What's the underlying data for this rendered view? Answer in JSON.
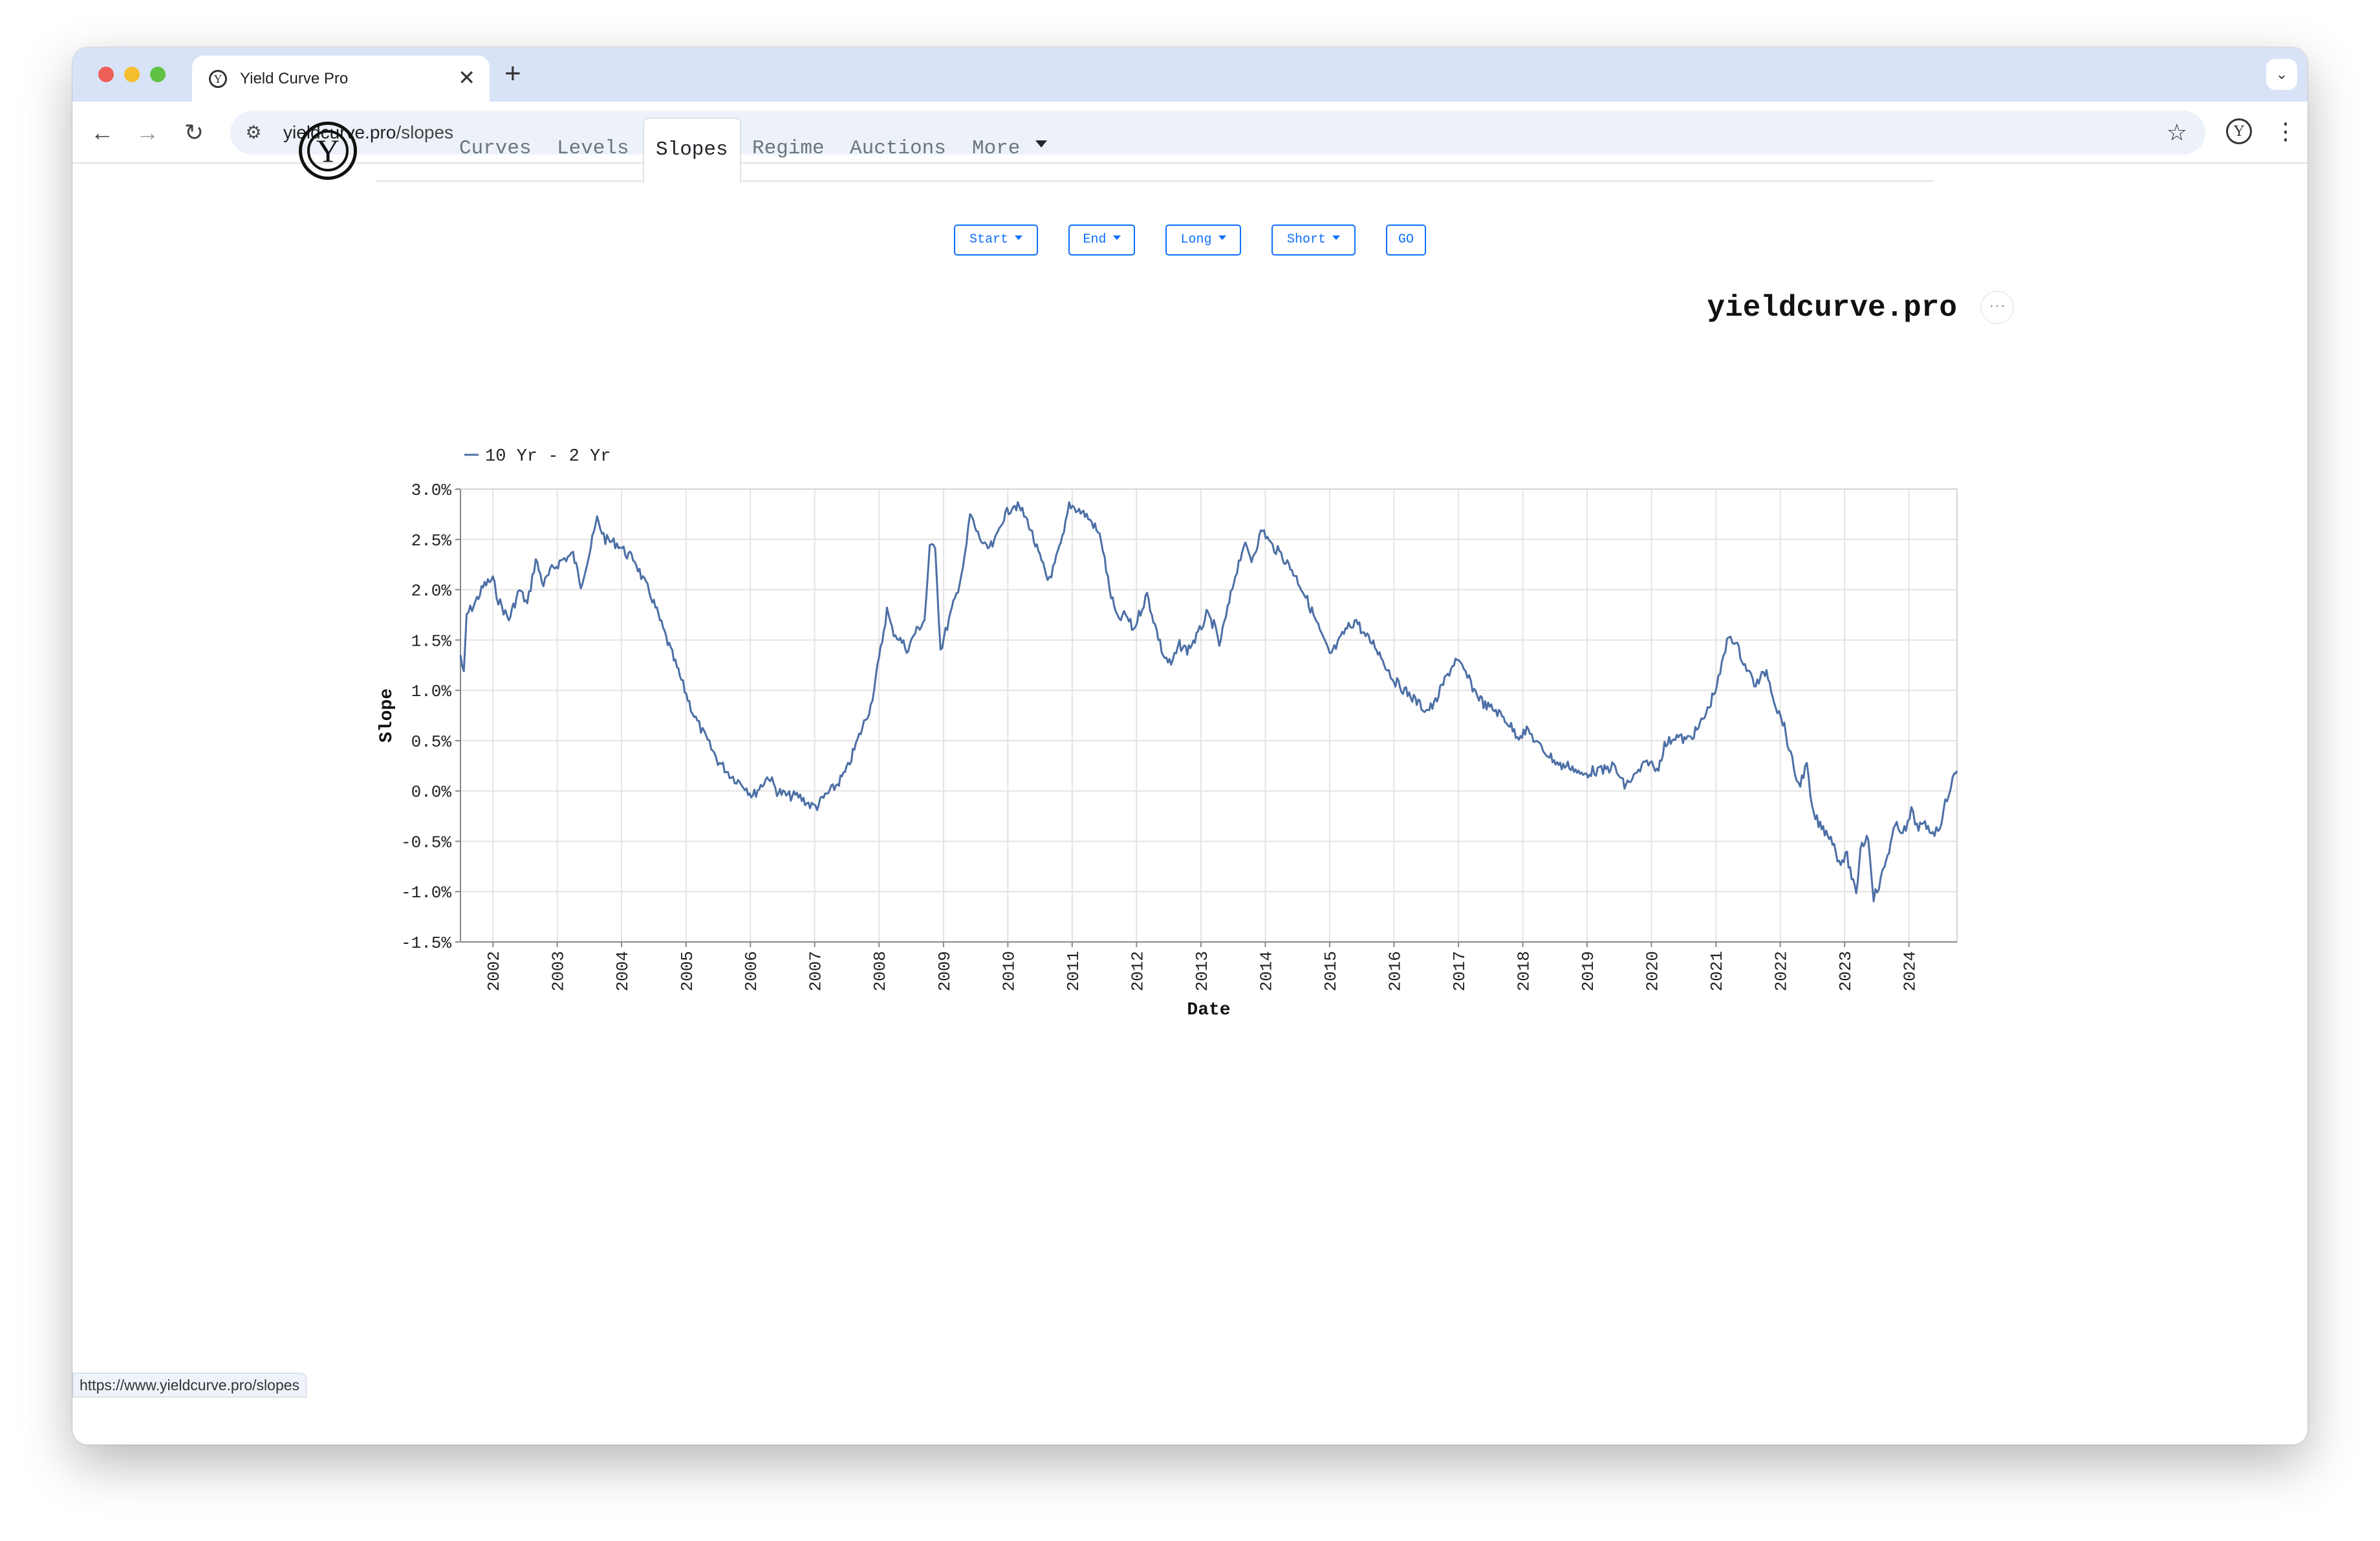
{
  "browser": {
    "tab_title": "Yield Curve Pro",
    "tab_close": "✕",
    "new_tab": "+",
    "url_domain": "yieldcurve.pro",
    "url_path": "/slopes",
    "status_url": "https://www.yieldcurve.pro/slopes"
  },
  "site": {
    "logo_letter": "Y",
    "nav": [
      "Curves",
      "Levels",
      "Slopes",
      "Regime",
      "Auctions",
      "More"
    ],
    "active_nav": "Slopes"
  },
  "filters": {
    "start": "Start",
    "end": "End",
    "long": "Long",
    "short": "Short",
    "go": "GO"
  },
  "chart_brand": "yieldcurve.pro",
  "chart_menu_icon": "···",
  "chart_data": {
    "type": "line",
    "title": "",
    "xlabel": "Date",
    "ylabel": "Slope",
    "x_tick_labels": [
      "2002",
      "2003",
      "2004",
      "2005",
      "2006",
      "2007",
      "2008",
      "2009",
      "2010",
      "2011",
      "2012",
      "2013",
      "2014",
      "2015",
      "2016",
      "2017",
      "2018",
      "2019",
      "2020",
      "2021",
      "2022",
      "2023",
      "2024"
    ],
    "y_tick_labels": [
      "3.0%",
      "2.5%",
      "2.0%",
      "1.5%",
      "1.0%",
      "0.5%",
      "0.0%",
      "-0.5%",
      "-1.0%",
      "-1.5%"
    ],
    "xlim": [
      "2001-07-01",
      "2024-09-30"
    ],
    "ylim": [
      -1.5,
      3.0
    ],
    "grid": true,
    "legend_position": "top-left",
    "color": "#4c6fa5",
    "series": [
      {
        "name": "10 Yr - 2 Yr",
        "points": [
          [
            "2001-07-01",
            1.35
          ],
          [
            "2001-07-20",
            1.15
          ],
          [
            "2001-08-05",
            1.75
          ],
          [
            "2001-09-15",
            1.85
          ],
          [
            "2001-11-15",
            2.05
          ],
          [
            "2001-12-31",
            2.1
          ],
          [
            "2002-02-01",
            1.9
          ],
          [
            "2002-04-01",
            1.7
          ],
          [
            "2002-06-01",
            2.0
          ],
          [
            "2002-07-15",
            1.85
          ],
          [
            "2002-09-01",
            2.3
          ],
          [
            "2002-10-15",
            2.05
          ],
          [
            "2002-12-01",
            2.2
          ],
          [
            "2003-02-01",
            2.3
          ],
          [
            "2003-04-01",
            2.35
          ],
          [
            "2003-05-15",
            2.05
          ],
          [
            "2003-07-01",
            2.35
          ],
          [
            "2003-08-15",
            2.7
          ],
          [
            "2003-10-01",
            2.5
          ],
          [
            "2003-12-15",
            2.45
          ],
          [
            "2004-02-01",
            2.35
          ],
          [
            "2004-03-15",
            2.3
          ],
          [
            "2004-05-01",
            2.1
          ],
          [
            "2004-06-15",
            1.95
          ],
          [
            "2004-08-15",
            1.65
          ],
          [
            "2004-10-15",
            1.35
          ],
          [
            "2004-12-15",
            1.05
          ],
          [
            "2005-02-15",
            0.75
          ],
          [
            "2005-04-15",
            0.55
          ],
          [
            "2005-07-01",
            0.3
          ],
          [
            "2005-09-15",
            0.15
          ],
          [
            "2005-12-01",
            0.05
          ],
          [
            "2006-01-15",
            -0.05
          ],
          [
            "2006-03-01",
            0.05
          ],
          [
            "2006-04-15",
            0.15
          ],
          [
            "2006-06-01",
            0.0
          ],
          [
            "2006-08-01",
            -0.05
          ],
          [
            "2006-10-01",
            -0.05
          ],
          [
            "2006-12-15",
            -0.15
          ],
          [
            "2007-01-15",
            -0.15
          ],
          [
            "2007-03-01",
            -0.05
          ],
          [
            "2007-05-01",
            0.05
          ],
          [
            "2007-07-01",
            0.2
          ],
          [
            "2007-09-01",
            0.5
          ],
          [
            "2007-11-15",
            0.85
          ],
          [
            "2008-01-01",
            1.3
          ],
          [
            "2008-02-15",
            1.8
          ],
          [
            "2008-03-15",
            1.6
          ],
          [
            "2008-05-01",
            1.5
          ],
          [
            "2008-06-15",
            1.4
          ],
          [
            "2008-07-15",
            1.55
          ],
          [
            "2008-09-15",
            1.7
          ],
          [
            "2008-10-15",
            2.4
          ],
          [
            "2008-11-15",
            2.45
          ],
          [
            "2008-12-15",
            1.4
          ],
          [
            "2009-02-01",
            1.7
          ],
          [
            "2009-03-15",
            1.95
          ],
          [
            "2009-05-01",
            2.3
          ],
          [
            "2009-06-01",
            2.75
          ],
          [
            "2009-07-15",
            2.55
          ],
          [
            "2009-09-01",
            2.4
          ],
          [
            "2009-10-15",
            2.45
          ],
          [
            "2009-12-01",
            2.7
          ],
          [
            "2010-02-01",
            2.85
          ],
          [
            "2010-03-15",
            2.8
          ],
          [
            "2010-05-01",
            2.65
          ],
          [
            "2010-06-15",
            2.4
          ],
          [
            "2010-08-15",
            2.1
          ],
          [
            "2010-09-15",
            2.2
          ],
          [
            "2010-11-15",
            2.55
          ],
          [
            "2010-12-15",
            2.85
          ],
          [
            "2011-02-01",
            2.8
          ],
          [
            "2011-03-15",
            2.75
          ],
          [
            "2011-05-01",
            2.65
          ],
          [
            "2011-06-15",
            2.5
          ],
          [
            "2011-08-01",
            2.0
          ],
          [
            "2011-09-15",
            1.7
          ],
          [
            "2011-11-01",
            1.75
          ],
          [
            "2011-12-15",
            1.6
          ],
          [
            "2012-01-15",
            1.75
          ],
          [
            "2012-03-01",
            1.95
          ],
          [
            "2012-04-15",
            1.65
          ],
          [
            "2012-06-01",
            1.35
          ],
          [
            "2012-07-15",
            1.25
          ],
          [
            "2012-09-01",
            1.45
          ],
          [
            "2012-10-15",
            1.4
          ],
          [
            "2012-12-15",
            1.55
          ],
          [
            "2013-02-01",
            1.75
          ],
          [
            "2013-03-15",
            1.65
          ],
          [
            "2013-04-15",
            1.45
          ],
          [
            "2013-06-01",
            1.8
          ],
          [
            "2013-07-15",
            2.15
          ],
          [
            "2013-09-01",
            2.45
          ],
          [
            "2013-10-15",
            2.3
          ],
          [
            "2013-12-15",
            2.6
          ],
          [
            "2014-02-01",
            2.45
          ],
          [
            "2014-04-01",
            2.35
          ],
          [
            "2014-06-01",
            2.2
          ],
          [
            "2014-08-01",
            2.0
          ],
          [
            "2014-10-01",
            1.75
          ],
          [
            "2014-11-15",
            1.55
          ],
          [
            "2015-01-01",
            1.35
          ],
          [
            "2015-02-15",
            1.45
          ],
          [
            "2015-04-01",
            1.6
          ],
          [
            "2015-06-01",
            1.7
          ],
          [
            "2015-07-15",
            1.55
          ],
          [
            "2015-09-15",
            1.45
          ],
          [
            "2015-11-15",
            1.25
          ],
          [
            "2016-01-01",
            1.1
          ],
          [
            "2016-03-01",
            1.0
          ],
          [
            "2016-05-01",
            0.9
          ],
          [
            "2016-07-01",
            0.8
          ],
          [
            "2016-08-15",
            0.85
          ],
          [
            "2016-10-15",
            1.1
          ],
          [
            "2016-12-15",
            1.3
          ],
          [
            "2017-02-01",
            1.2
          ],
          [
            "2017-04-01",
            1.0
          ],
          [
            "2017-06-01",
            0.85
          ],
          [
            "2017-08-01",
            0.8
          ],
          [
            "2017-10-01",
            0.7
          ],
          [
            "2017-12-01",
            0.55
          ],
          [
            "2018-02-01",
            0.6
          ],
          [
            "2018-04-01",
            0.45
          ],
          [
            "2018-06-01",
            0.35
          ],
          [
            "2018-08-01",
            0.25
          ],
          [
            "2018-10-01",
            0.25
          ],
          [
            "2018-12-01",
            0.15
          ],
          [
            "2019-02-01",
            0.2
          ],
          [
            "2019-04-01",
            0.2
          ],
          [
            "2019-06-01",
            0.25
          ],
          [
            "2019-08-01",
            0.05
          ],
          [
            "2019-10-01",
            0.15
          ],
          [
            "2019-12-15",
            0.3
          ],
          [
            "2020-02-01",
            0.2
          ],
          [
            "2020-03-15",
            0.45
          ],
          [
            "2020-05-15",
            0.55
          ],
          [
            "2020-07-15",
            0.5
          ],
          [
            "2020-09-15",
            0.6
          ],
          [
            "2020-11-15",
            0.8
          ],
          [
            "2021-01-15",
            1.1
          ],
          [
            "2021-03-15",
            1.55
          ],
          [
            "2021-04-15",
            1.5
          ],
          [
            "2021-06-15",
            1.25
          ],
          [
            "2021-08-15",
            1.05
          ],
          [
            "2021-10-15",
            1.2
          ],
          [
            "2021-12-15",
            0.8
          ],
          [
            "2022-01-15",
            0.7
          ],
          [
            "2022-03-01",
            0.35
          ],
          [
            "2022-04-15",
            0.05
          ],
          [
            "2022-06-01",
            0.25
          ],
          [
            "2022-07-01",
            -0.2
          ],
          [
            "2022-08-15",
            -0.35
          ],
          [
            "2022-10-15",
            -0.45
          ],
          [
            "2022-12-01",
            -0.7
          ],
          [
            "2023-01-15",
            -0.65
          ],
          [
            "2023-03-08",
            -1.05
          ],
          [
            "2023-04-01",
            -0.55
          ],
          [
            "2023-05-15",
            -0.45
          ],
          [
            "2023-06-15",
            -1.05
          ],
          [
            "2023-07-15",
            -0.95
          ],
          [
            "2023-08-15",
            -0.75
          ],
          [
            "2023-10-15",
            -0.35
          ],
          [
            "2023-12-15",
            -0.4
          ],
          [
            "2024-01-15",
            -0.2
          ],
          [
            "2024-02-15",
            -0.35
          ],
          [
            "2024-04-01",
            -0.35
          ],
          [
            "2024-05-15",
            -0.4
          ],
          [
            "2024-06-15",
            -0.4
          ],
          [
            "2024-07-15",
            -0.2
          ],
          [
            "2024-08-15",
            0.0
          ],
          [
            "2024-09-15",
            0.15
          ],
          [
            "2024-09-30",
            0.2
          ]
        ]
      }
    ]
  }
}
